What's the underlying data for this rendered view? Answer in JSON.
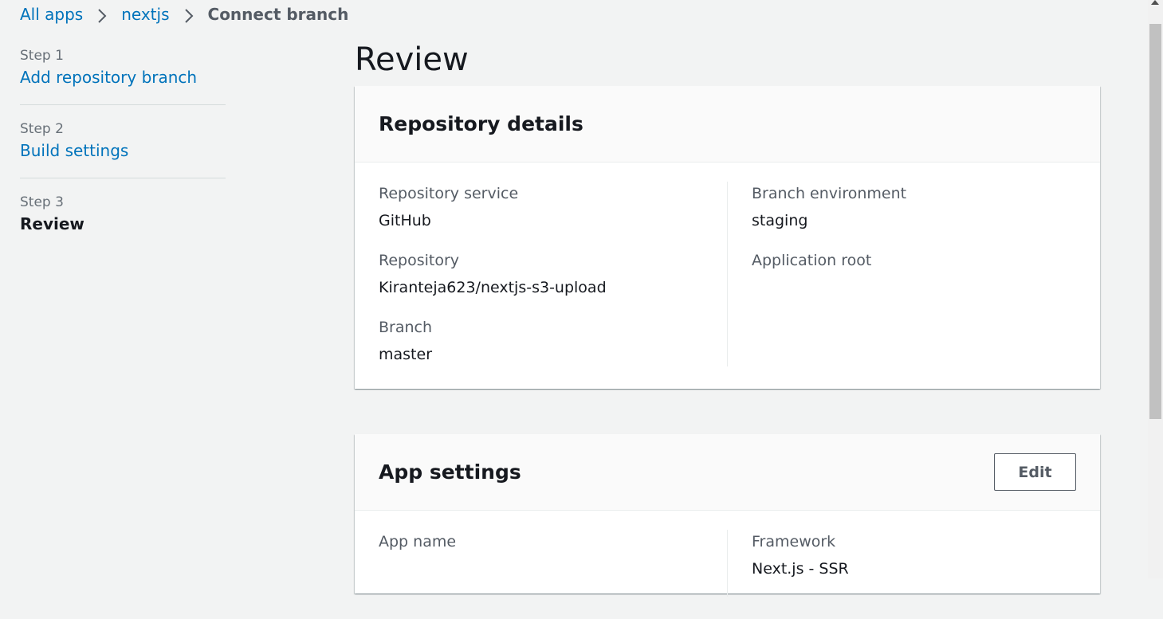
{
  "breadcrumb": {
    "items": [
      "All apps",
      "nextjs"
    ],
    "current": "Connect branch"
  },
  "steps": [
    {
      "num": "Step 1",
      "label": "Add repository branch"
    },
    {
      "num": "Step 2",
      "label": "Build settings"
    },
    {
      "num": "Step 3",
      "label": "Review"
    }
  ],
  "page": {
    "title": "Review"
  },
  "repository_details": {
    "title": "Repository details",
    "left": [
      {
        "label": "Repository service",
        "value": "GitHub"
      },
      {
        "label": "Repository",
        "value": "Kiranteja623/nextjs-s3-upload"
      },
      {
        "label": "Branch",
        "value": "master"
      }
    ],
    "right": [
      {
        "label": "Branch environment",
        "value": "staging"
      },
      {
        "label": "Application root",
        "value": ""
      }
    ]
  },
  "app_settings": {
    "title": "App settings",
    "edit_label": "Edit",
    "left": [
      {
        "label": "App name",
        "value": ""
      }
    ],
    "right": [
      {
        "label": "Framework",
        "value": "Next.js - SSR"
      }
    ]
  }
}
